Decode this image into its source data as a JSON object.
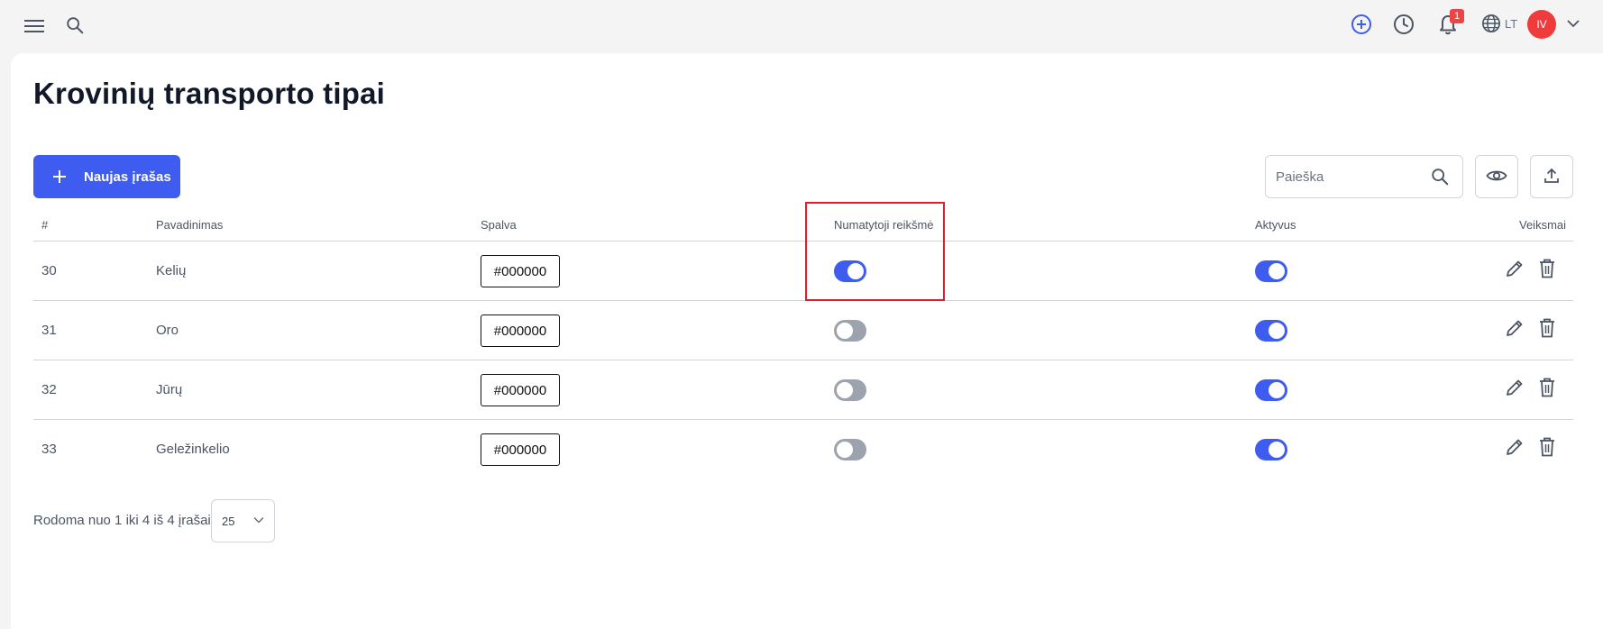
{
  "topbar": {
    "language": "LT",
    "notifications_count": "1",
    "user_initials": "IV"
  },
  "page": {
    "title": "Krovinių transporto tipai",
    "new_button_label": "Naujas įrašas",
    "search_placeholder": "Paieška"
  },
  "table": {
    "columns": {
      "id": "#",
      "name": "Pavadinimas",
      "color": "Spalva",
      "default": "Numatytoji reikšmė",
      "active": "Aktyvus",
      "actions": "Veiksmai"
    },
    "rows": [
      {
        "id": "30",
        "name": "Kelių",
        "color": "#000000",
        "default": true,
        "active": true
      },
      {
        "id": "31",
        "name": "Oro",
        "color": "#000000",
        "default": false,
        "active": true
      },
      {
        "id": "32",
        "name": "Jūrų",
        "color": "#000000",
        "default": false,
        "active": true
      },
      {
        "id": "33",
        "name": "Geležinkelio",
        "color": "#000000",
        "default": false,
        "active": true
      }
    ]
  },
  "footer": {
    "summary": "Rodoma nuo 1 iki 4 iš 4 įrašai",
    "page_size": "25"
  },
  "colors": {
    "accent": "#3e5cf0",
    "toggle_off": "#9ca3af",
    "highlight": "#e11d2e",
    "avatar": "#ef3b3b"
  }
}
